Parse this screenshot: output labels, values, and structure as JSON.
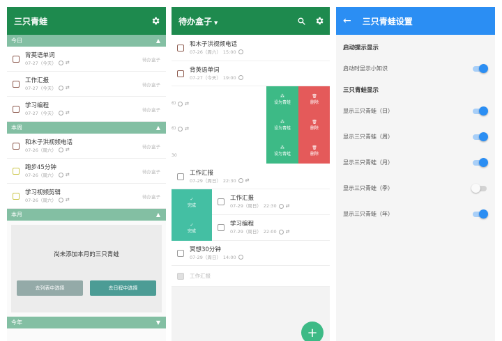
{
  "screen1": {
    "title": "三只青蛙",
    "sections": [
      {
        "label": "今日",
        "items": [
          {
            "title": "背英语单词",
            "date": "07-27（今天）",
            "pick": "待办盒子"
          },
          {
            "title": "工作汇报",
            "date": "07-27（今天）",
            "pick": "待办盒子"
          },
          {
            "title": "学习编程",
            "date": "07-27（今天）",
            "pick": "待办盒子"
          }
        ]
      },
      {
        "label": "本周",
        "items": [
          {
            "title": "和木子洪视频电话",
            "date": "07-26（周六）",
            "pick": "待办盒子"
          },
          {
            "title": "跑步45分钟",
            "date": "07-26（周六）",
            "pick": "待办盒子"
          },
          {
            "title": "学习视频剪辑",
            "date": "07-26（周六）",
            "pick": "待办盒子"
          }
        ]
      },
      {
        "label": "本月"
      },
      {
        "label": "今年"
      }
    ],
    "empty_text": "尚未添加本月的三只青蛙",
    "btn_from_list": "去列表中选择",
    "btn_from_box": "去日程中选择"
  },
  "screen2": {
    "title": "待办盒子",
    "items": [
      {
        "title": "和木子洪视频电话",
        "date": "07-26（周六）",
        "time": "15:00"
      },
      {
        "title": "背英语单词",
        "date": "07-27（今天）",
        "time": "19:00"
      },
      {
        "title": "工作汇报",
        "date": "07-29（周日）",
        "time": "22:30"
      },
      {
        "title": "工作汇报",
        "date": "07-29（周日）",
        "time": "22:30"
      },
      {
        "title": "学习编程",
        "date": "07-29（周日）",
        "time": "22:00"
      },
      {
        "title": "冥想30分钟",
        "date": "07-29（周日）",
        "time": "14:00"
      },
      {
        "title": "工作汇报"
      }
    ],
    "action_set": "设为青蛙",
    "action_delete": "删除",
    "action_done": "完成",
    "ghost_30": "30",
    "fab": "+"
  },
  "screen3": {
    "title": "三只青蛙设置",
    "section_startup": "启动提示显示",
    "startup_row": "启动时显示小知识",
    "section_display": "三只青蛙显示",
    "rows": [
      {
        "label": "显示三只青蛙（日）",
        "on": true
      },
      {
        "label": "显示三只青蛙（周）",
        "on": true
      },
      {
        "label": "显示三只青蛙（月）",
        "on": true
      },
      {
        "label": "显示三只青蛙（季）",
        "on": false
      },
      {
        "label": "显示三只青蛙（年）",
        "on": true
      }
    ]
  }
}
